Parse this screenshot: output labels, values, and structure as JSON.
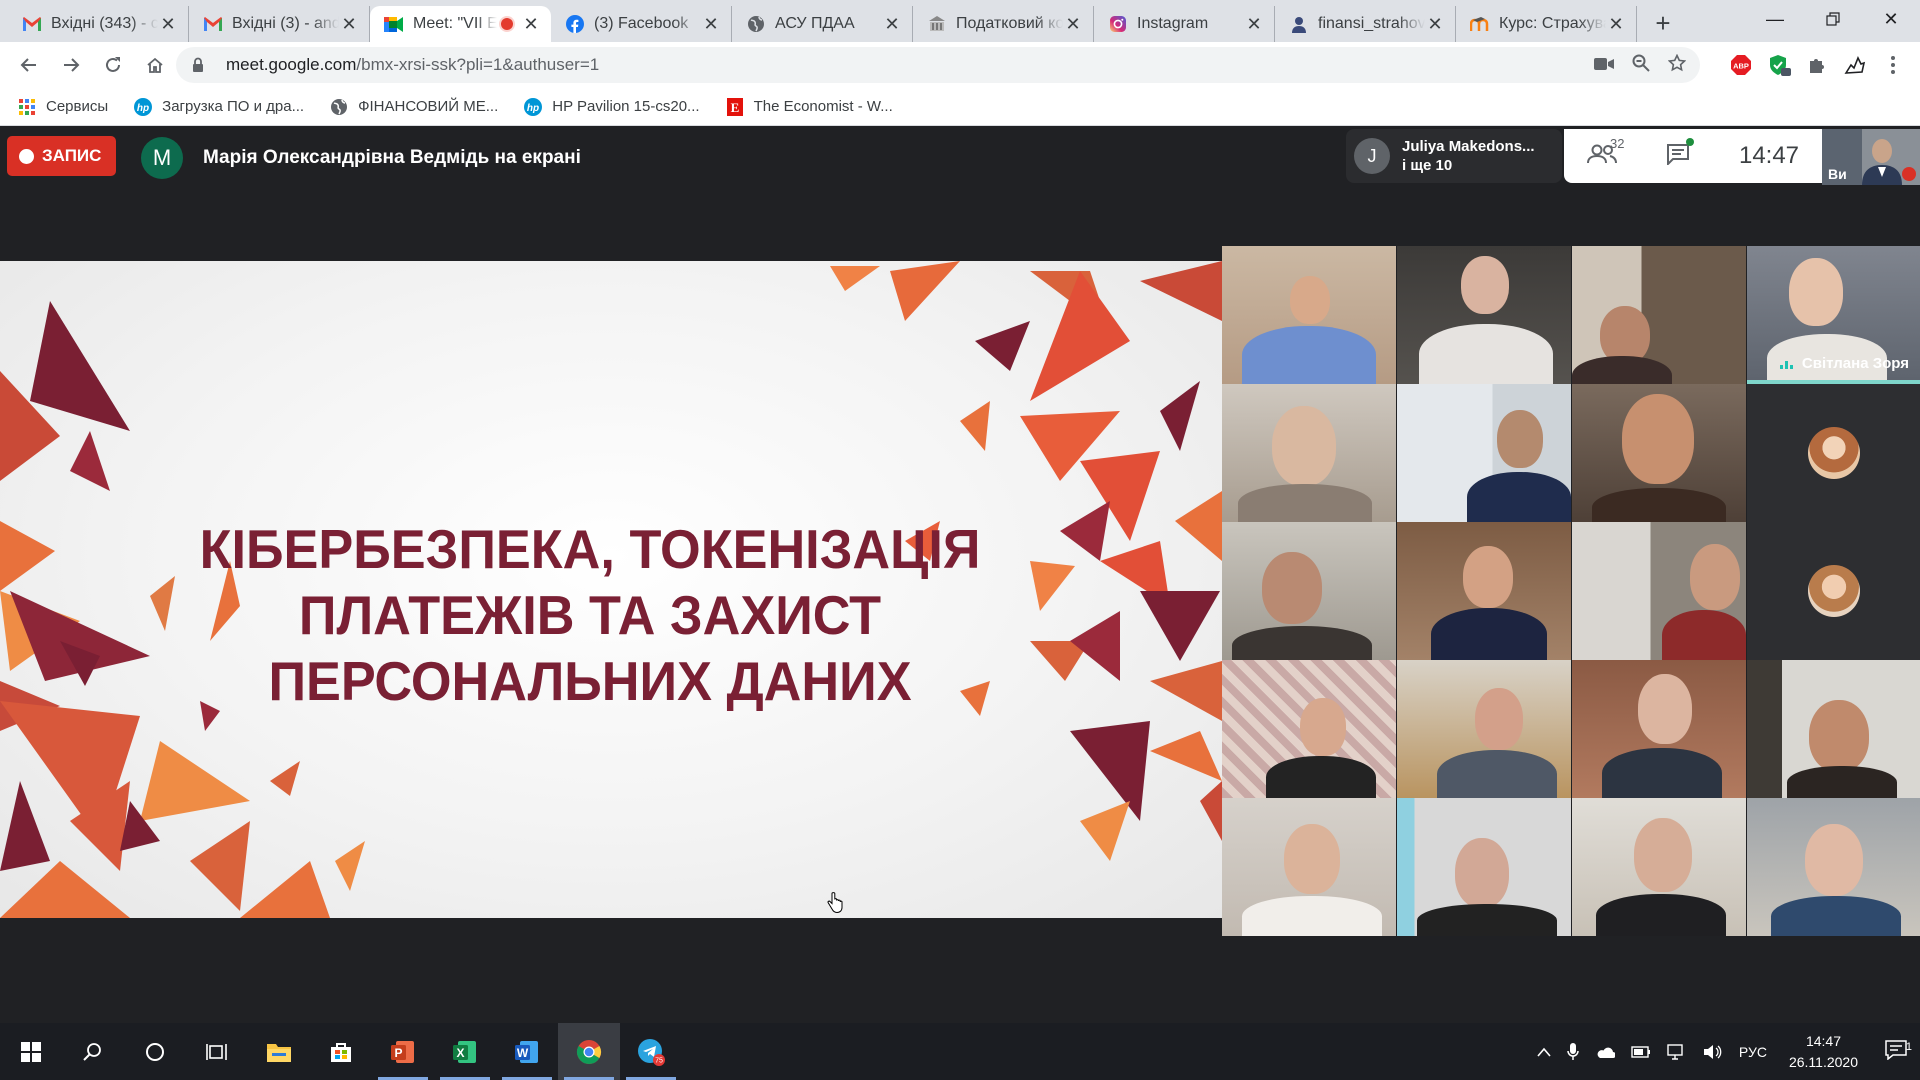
{
  "browser": {
    "tabs": [
      {
        "title": "Вхідні (343) - c",
        "favicon": "gmail-icon"
      },
      {
        "title": "Вхідні (3) - and",
        "favicon": "gmail-icon"
      },
      {
        "title": "Meet: \"VII Е",
        "favicon": "meet-icon",
        "active": true,
        "recording": true
      },
      {
        "title": "(3) Facebook",
        "favicon": "facebook-icon"
      },
      {
        "title": "АСУ ПДАА",
        "favicon": "globe-icon"
      },
      {
        "title": "Податковий ко",
        "favicon": "document-icon"
      },
      {
        "title": "Instagram",
        "favicon": "instagram-icon"
      },
      {
        "title": "finansi_strahov",
        "favicon": "person-icon"
      },
      {
        "title": "Курс: Страхува",
        "favicon": "moodle-icon"
      }
    ],
    "url_host": "meet.google.com",
    "url_path": "/bmx-xrsi-ssk?pli=1&authuser=1",
    "bookmarks": [
      {
        "label": "Сервисы",
        "icon": "apps-grid-icon"
      },
      {
        "label": "Загрузка ПО и дра...",
        "icon": "hp-icon"
      },
      {
        "label": "ФІНАНСОВИЙ МЕ...",
        "icon": "globe-icon"
      },
      {
        "label": "HP Pavilion 15-cs20...",
        "icon": "hp-icon"
      },
      {
        "label": "The Economist - W...",
        "icon": "economist-icon"
      }
    ],
    "extensions": {
      "abp_label": "ABP"
    }
  },
  "meet": {
    "recording_label": "ЗАПИС",
    "presenter_initial": "M",
    "presenter_text": "Марія Олександрівна Ведмідь на екрані",
    "speaker": {
      "initial": "J",
      "name": "Juliya Makedons...",
      "others": "і ще 10"
    },
    "participant_count": "32",
    "time": "14:47",
    "self_label": "Ви",
    "slide_title_lines": [
      "КІБЕРБЕЗПЕКА, ТОКЕНІЗАЦІЯ",
      "ПЛАТЕЖІВ ТА ЗАХИСТ",
      "ПЕРСОНАЛЬНИХ ДАНИХ"
    ],
    "active_participant_name": "Світлана Зоря",
    "colors": {
      "recording": "#d93025",
      "slide_title": "#7a2034",
      "accent_teal": "#7fd6cb"
    }
  },
  "taskbar": {
    "apps": [
      "windows-start-icon",
      "search-icon",
      "cortana-icon",
      "task-view-icon",
      "file-explorer-icon",
      "store-icon",
      "powerpoint-icon",
      "excel-icon",
      "word-icon",
      "chrome-icon",
      "telegram-icon"
    ],
    "telegram_badge": "75",
    "language": "РУС",
    "time": "14:47",
    "date": "26.11.2020",
    "notifications": "1"
  }
}
